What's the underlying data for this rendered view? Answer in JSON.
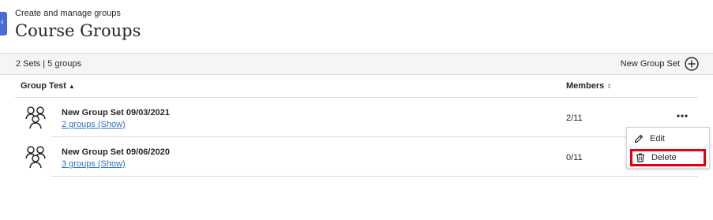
{
  "header": {
    "subtitle": "Create and manage groups",
    "title": "Course Groups",
    "accent_color": "#4a6ad8"
  },
  "toolbar": {
    "sets_count": "2 Sets | 5 groups",
    "new_group_set_label": "New Group Set"
  },
  "table": {
    "columns": [
      {
        "label": "Group Test",
        "sort": "ascending"
      },
      {
        "label": "Members",
        "sort": "unsorted"
      }
    ],
    "rows": [
      {
        "title": "New Group Set 09/03/2021",
        "link": "2 groups (Show)",
        "members": "2/11",
        "icon": "group-people-icon"
      },
      {
        "title": "New Group Set 09/06/2020",
        "link": "3 groups (Show)",
        "members": "0/11",
        "icon": "group-people-icon"
      }
    ]
  },
  "context_menu": {
    "items": [
      {
        "label": "Edit",
        "icon": "pencil-icon"
      },
      {
        "label": "Delete",
        "icon": "trash-icon",
        "highlighted": true,
        "highlight_color": "#e00010"
      }
    ]
  },
  "colors": {
    "link": "#2e72c4",
    "toolbar_bg": "#f5f5f5",
    "divider": "#dcdcdc"
  }
}
